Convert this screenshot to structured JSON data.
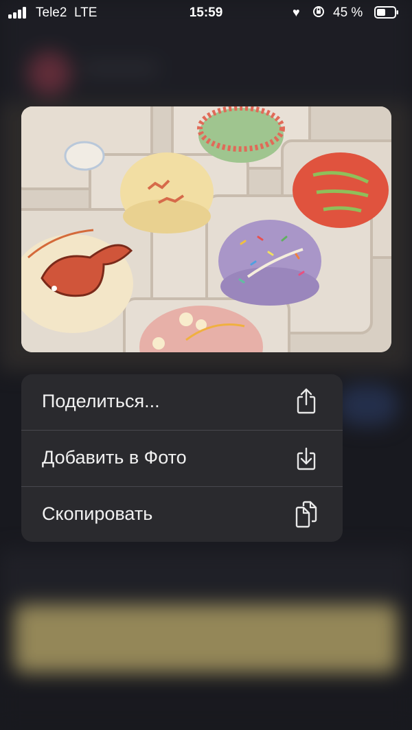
{
  "status_bar": {
    "carrier": "Tele2",
    "network": "LTE",
    "time": "15:59",
    "battery_percent": "45 %",
    "heart_icon": "♥"
  },
  "photo": {
    "description_icon": "cake-photo"
  },
  "menu": {
    "items": [
      {
        "label": "Поделиться...",
        "icon": "share-icon"
      },
      {
        "label": "Добавить в Фото",
        "icon": "save-to-photos-icon"
      },
      {
        "label": "Скопировать",
        "icon": "copy-icon"
      }
    ]
  },
  "colors": {
    "menu_bg": "#2a2a2e",
    "separator": "#48484e",
    "text": "#f2f2f2"
  }
}
